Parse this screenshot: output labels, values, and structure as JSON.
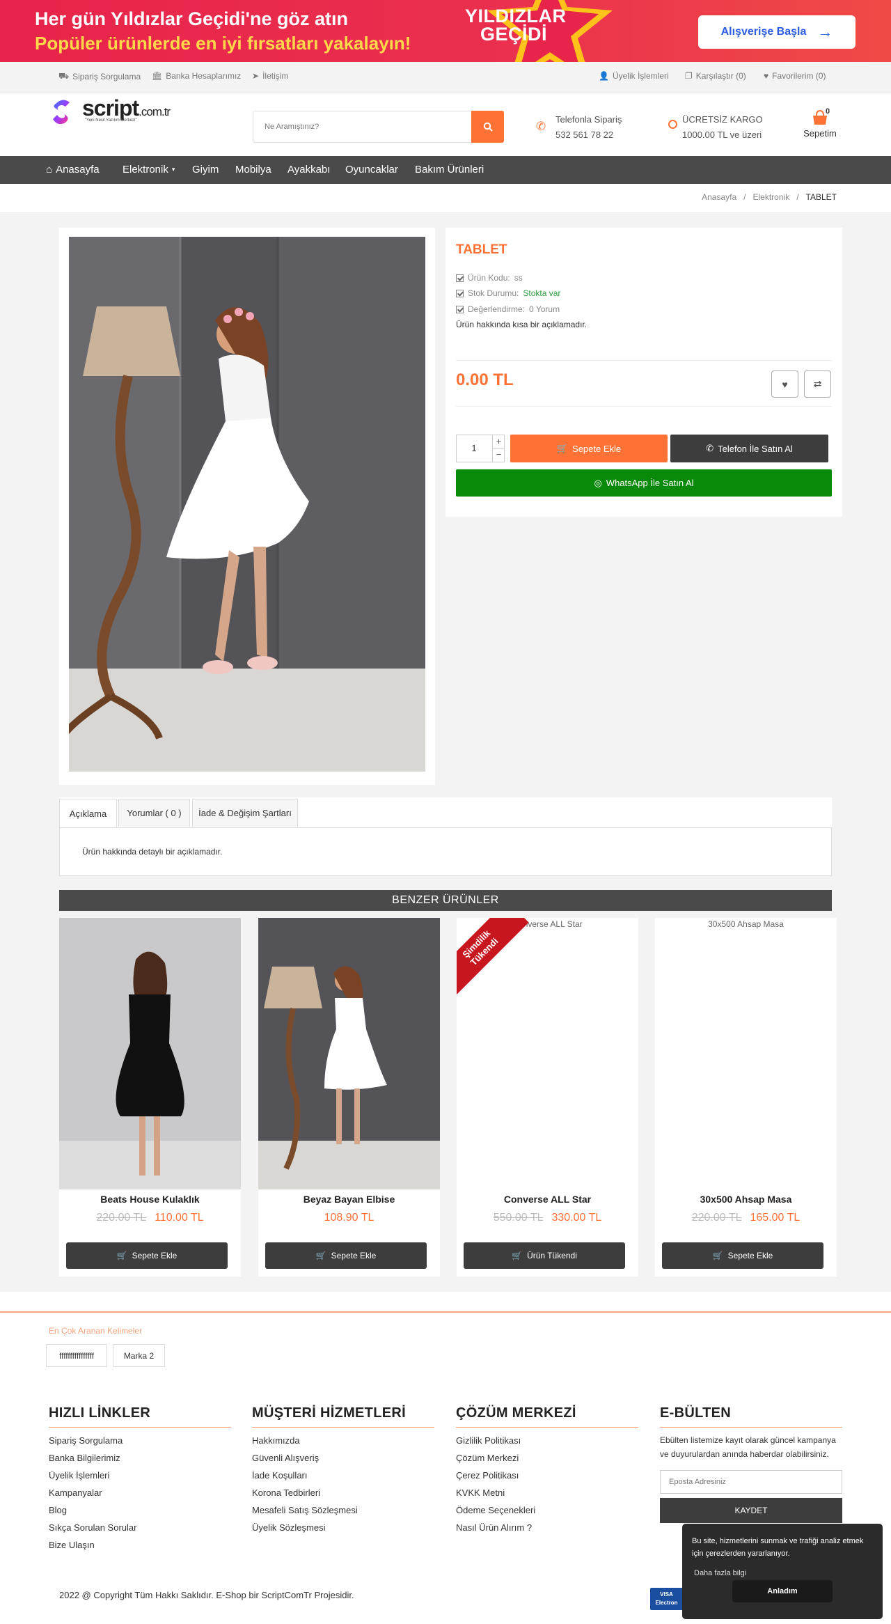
{
  "banner": {
    "line1": "Her gün Yıldızlar Geçidi'ne göz atın",
    "line2": "Popüler ürünlerde en iyi fırsatları yakalayın!",
    "badge_line1": "YILDIZLAR",
    "badge_line2": "GEÇİDİ",
    "cta": "Alışverişe Başla"
  },
  "topbar": {
    "order_tracking": "Sipariş Sorgulama",
    "bank_accounts": "Banka Hesaplarımız",
    "contact": "İletişim",
    "membership": "Üyelik İşlemleri",
    "compare": "Karşılaştır (0)",
    "favorites": "Favorilerim (0)"
  },
  "logo": {
    "word": "script",
    "suffix": ".com.tr",
    "tagline": "\"Yeni Nesil Yazılım Merkezi\""
  },
  "search": {
    "placeholder": "Ne Aramıştınız?"
  },
  "phone": {
    "label": "Telefonla Sipariş",
    "number": "532 561 78 22"
  },
  "shipping": {
    "label": "ÜCRETSİZ KARGO",
    "value": "1000.00 TL ve üzeri"
  },
  "cart": {
    "count": "0",
    "label": "Sepetim"
  },
  "nav": {
    "home": "Anasayfa",
    "items": [
      "Elektronik",
      "Giyim",
      "Mobilya",
      "Ayakkabı",
      "Oyuncaklar",
      "Bakım Ürünleri"
    ]
  },
  "breadcrumb": {
    "items": [
      "Anasayfa",
      "Elektronik"
    ],
    "current": "TABLET"
  },
  "product": {
    "title": "TABLET",
    "code_label": "Ürün Kodu:",
    "code": "ss",
    "stock_label": "Stok Durumu:",
    "stock": "Stokta var",
    "rating_label": "Değerlendirme:",
    "rating": "0 Yorum",
    "short_desc": "Ürün hakkında kısa bir açıklamadır.",
    "price": "0.00 TL",
    "qty": "1",
    "add_to_cart": "Sepete Ekle",
    "buy_phone": "Telefon İle Satın Al",
    "buy_whatsapp": "WhatsApp İle Satın Al"
  },
  "tabs": {
    "desc": "Açıklama",
    "reviews": "Yorumlar ( 0 )",
    "returns": "İade & Değişim Şartları",
    "desc_text": "Ürün hakkında detaylı bir açıklamadır."
  },
  "similar": {
    "title": "BENZER ÜRÜNLER",
    "items": [
      {
        "name": "Beats House Kulaklık",
        "old": "220.00 TL",
        "new": "110.00 TL",
        "button": "Sepete Ekle"
      },
      {
        "name": "Beyaz Bayan Elbise",
        "old": "",
        "new": "108.90 TL",
        "button": "Sepete Ekle"
      },
      {
        "name": "Converse ALL Star",
        "old": "550.00 TL",
        "new": "330.00 TL",
        "button": "Ürün Tükendi",
        "alt": "Converse ALL Star",
        "ribbon1": "Şimdilik",
        "ribbon2": "Tükendi"
      },
      {
        "name": "30x500 Ahsap Masa",
        "old": "220.00 TL",
        "new": "165.00 TL",
        "button": "Sepete Ekle",
        "alt": "30x500 Ahsap Masa"
      }
    ]
  },
  "tags": {
    "title": "En Çok Aranan Kelimeler",
    "items": [
      "ffffffffffffffff",
      "Marka 2"
    ]
  },
  "footer": {
    "quick": {
      "title": "HIZLI LİNKLER",
      "items": [
        "Sipariş Sorgulama",
        "Banka Bilgilerimiz",
        "Üyelik İşlemleri",
        "Kampanyalar",
        "Blog",
        "Sıkça Sorulan Sorular",
        "Bize Ulaşın"
      ]
    },
    "customer": {
      "title": "MÜŞTERİ HİZMETLERİ",
      "items": [
        "Hakkımızda",
        "Güvenli Alışveriş",
        "İade Koşulları",
        "Korona Tedbirleri",
        "Mesafeli Satış Sözleşmesi",
        "Üyelik Sözleşmesi"
      ]
    },
    "solution": {
      "title": "ÇÖZÜM MERKEZİ",
      "items": [
        "Gizlilik Politikası",
        "Çözüm Merkezi",
        "Çerez Politikası",
        "KVKK Metni",
        "Ödeme Seçenekleri",
        "Nasıl Ürün Alırım ?"
      ]
    },
    "newsletter": {
      "title": "E-BÜLTEN",
      "text": "Ebülten listemize kayıt olarak güncel kampanya ve duyurulardan anında haberdar olabilirsiniz.",
      "placeholder": "Eposta Adresiniz",
      "button": "KAYDET"
    },
    "copyright": "2022 @ Copyright Tüm Hakkı Saklıdır. E-Shop bir ScriptComTr Projesidir."
  },
  "cookie": {
    "text": "Bu site, hizmetlerini sunmak ve trafiği analiz etmek için çerezlerden yararlanıyor.",
    "link": "Daha fazla bilgi",
    "button": "Anladım"
  },
  "colors": {
    "accent": "#ff7235",
    "nav": "#4a4a4a",
    "banner": "#e7244a",
    "whatsapp": "#0a8a0a",
    "dark_button": "#3d3d3d"
  }
}
